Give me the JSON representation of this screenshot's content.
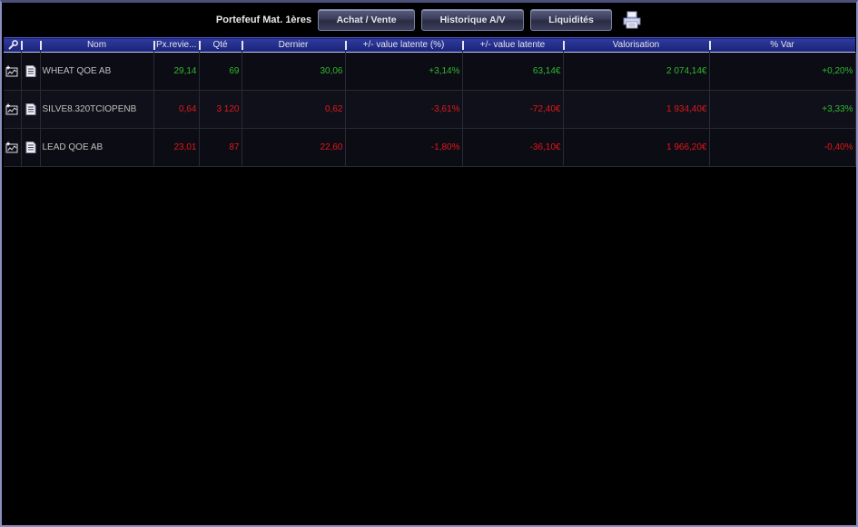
{
  "toolbar": {
    "title": "Portefeuf Mat. 1ères",
    "buttons": [
      "Achat / Vente",
      "Historique A/V",
      "Liquidités"
    ],
    "print_icon": "printer-icon"
  },
  "table": {
    "header_icon": "wrench-icon",
    "columns": [
      "Nom",
      "Px.revie...",
      "Qté",
      "Dernier",
      "+/- value latente (%)",
      "+/- value latente",
      "Valorisation",
      "% Var"
    ],
    "rows": [
      {
        "nom": "WHEAT QOE AB",
        "px_revient": "29,14",
        "qte": "69",
        "dernier": "30,06",
        "value_latente_pct": "+3,14%",
        "value_latente": "63,14€",
        "valorisation": "2 074,14€",
        "var": "+0,20%",
        "colors": {
          "px_revient": "pos",
          "qte": "pos",
          "dernier": "pos",
          "value_latente_pct": "pos",
          "value_latente": "pos",
          "valorisation": "pos",
          "var": "pos"
        }
      },
      {
        "nom": "SILVE8.320TCIOPENB",
        "px_revient": "0,64",
        "qte": "3 120",
        "dernier": "0,62",
        "value_latente_pct": "-3,61%",
        "value_latente": "-72,40€",
        "valorisation": "1 934,40€",
        "var": "+3,33%",
        "colors": {
          "px_revient": "neg",
          "qte": "neg",
          "dernier": "neg",
          "value_latente_pct": "neg",
          "value_latente": "neg",
          "valorisation": "neg",
          "var": "pos"
        }
      },
      {
        "nom": "LEAD QOE AB",
        "px_revient": "23,01",
        "qte": "87",
        "dernier": "22,60",
        "value_latente_pct": "-1,80%",
        "value_latente": "-36,10€",
        "valorisation": "1 966,20€",
        "var": "-0,40%",
        "colors": {
          "px_revient": "neg",
          "qte": "neg",
          "dernier": "neg",
          "value_latente_pct": "neg",
          "value_latente": "neg",
          "valorisation": "neg",
          "var": "neg"
        }
      }
    ],
    "row_icons": [
      "chart-add-icon",
      "document-icon"
    ]
  },
  "colors": {
    "positive": "#2fb82f",
    "negative": "#e01818",
    "header": "#1c2478",
    "background": "#000000"
  }
}
